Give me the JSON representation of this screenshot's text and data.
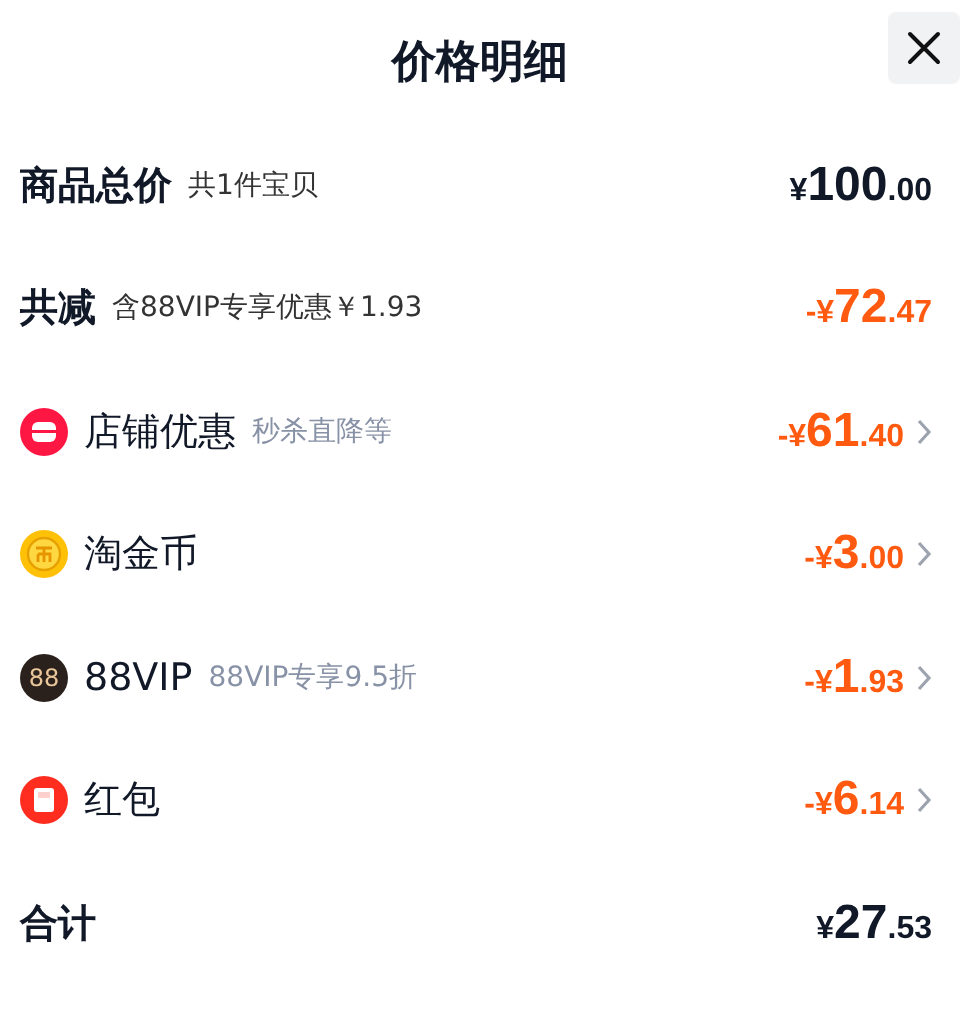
{
  "title": "价格明细",
  "rows": [
    {
      "kind": "summary",
      "label": "商品总价",
      "note": "共1件宝贝",
      "prefix": "¥",
      "whole": "100",
      "cents": ".00"
    },
    {
      "kind": "saving",
      "label": "共减",
      "note": "含88VIP专享优惠￥1.93",
      "prefix": "-¥",
      "whole": "72",
      "cents": ".47"
    },
    {
      "kind": "discount",
      "label": "店铺优惠",
      "note": "秒杀直降等",
      "prefix": "-¥",
      "whole": "61",
      "cents": ".40"
    },
    {
      "kind": "discount",
      "label": "淘金币",
      "prefix": "-¥",
      "whole": "3",
      "cents": ".00"
    },
    {
      "kind": "discount",
      "icon_text": "88",
      "label": "88VIP",
      "note": "88VIP专享9.5折",
      "prefix": "-¥",
      "whole": "1",
      "cents": ".93"
    },
    {
      "kind": "discount",
      "label": "红包",
      "prefix": "-¥",
      "whole": "6",
      "cents": ".14"
    },
    {
      "kind": "summary",
      "label": "合计",
      "prefix": "¥",
      "whole": "27",
      "cents": ".53"
    }
  ]
}
